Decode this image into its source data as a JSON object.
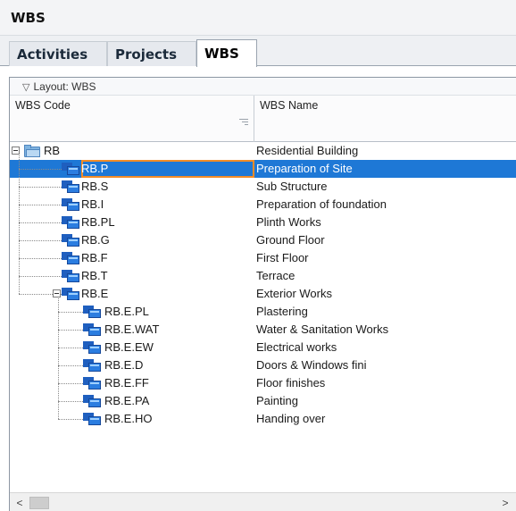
{
  "window": {
    "title": "WBS"
  },
  "tabs": [
    {
      "label": "Activities"
    },
    {
      "label": "Projects"
    },
    {
      "label": "WBS",
      "active": true
    }
  ],
  "layout": {
    "label": "Layout: WBS"
  },
  "columns": {
    "code": "WBS Code",
    "name": "WBS Name"
  },
  "rows": [
    {
      "code": "RB",
      "name": "Residential Building",
      "level": 0,
      "expanded": true,
      "icon": "folder-icon"
    },
    {
      "code": "RB.P",
      "name": "Preparation of Site",
      "level": 1,
      "selected": true,
      "icon": "wbs-icon"
    },
    {
      "code": "RB.S",
      "name": "Sub Structure",
      "level": 1,
      "icon": "wbs-icon"
    },
    {
      "code": "RB.I",
      "name": "Preparation of foundation",
      "level": 1,
      "icon": "wbs-icon"
    },
    {
      "code": "RB.PL",
      "name": "Plinth Works",
      "level": 1,
      "icon": "wbs-icon"
    },
    {
      "code": "RB.G",
      "name": "Ground Floor",
      "level": 1,
      "icon": "wbs-icon"
    },
    {
      "code": "RB.F",
      "name": "First Floor",
      "level": 1,
      "icon": "wbs-icon"
    },
    {
      "code": "RB.T",
      "name": "Terrace",
      "level": 1,
      "icon": "wbs-icon"
    },
    {
      "code": "RB.E",
      "name": "Exterior Works",
      "level": 1,
      "expanded": true,
      "icon": "wbs-icon"
    },
    {
      "code": "RB.E.PL",
      "name": "Plastering",
      "level": 2,
      "icon": "wbs-icon"
    },
    {
      "code": "RB.E.WAT",
      "name": "Water & Sanitation Works",
      "level": 2,
      "icon": "wbs-icon"
    },
    {
      "code": "RB.E.EW",
      "name": "Electrical works",
      "level": 2,
      "icon": "wbs-icon"
    },
    {
      "code": "RB.E.D",
      "name": "Doors & Windows fini",
      "level": 2,
      "icon": "wbs-icon"
    },
    {
      "code": "RB.E.FF",
      "name": "Floor finishes",
      "level": 2,
      "icon": "wbs-icon"
    },
    {
      "code": "RB.E.PA",
      "name": "Painting",
      "level": 2,
      "icon": "wbs-icon"
    },
    {
      "code": "RB.E.HO",
      "name": "Handing over",
      "level": 2,
      "icon": "wbs-icon"
    }
  ],
  "scrollbar": {
    "left_arrow": "<",
    "right_arrow": ">"
  },
  "colors": {
    "selection": "#1e78d6",
    "focus_border": "#f28c28",
    "icon_blue": "#2b7de0"
  }
}
